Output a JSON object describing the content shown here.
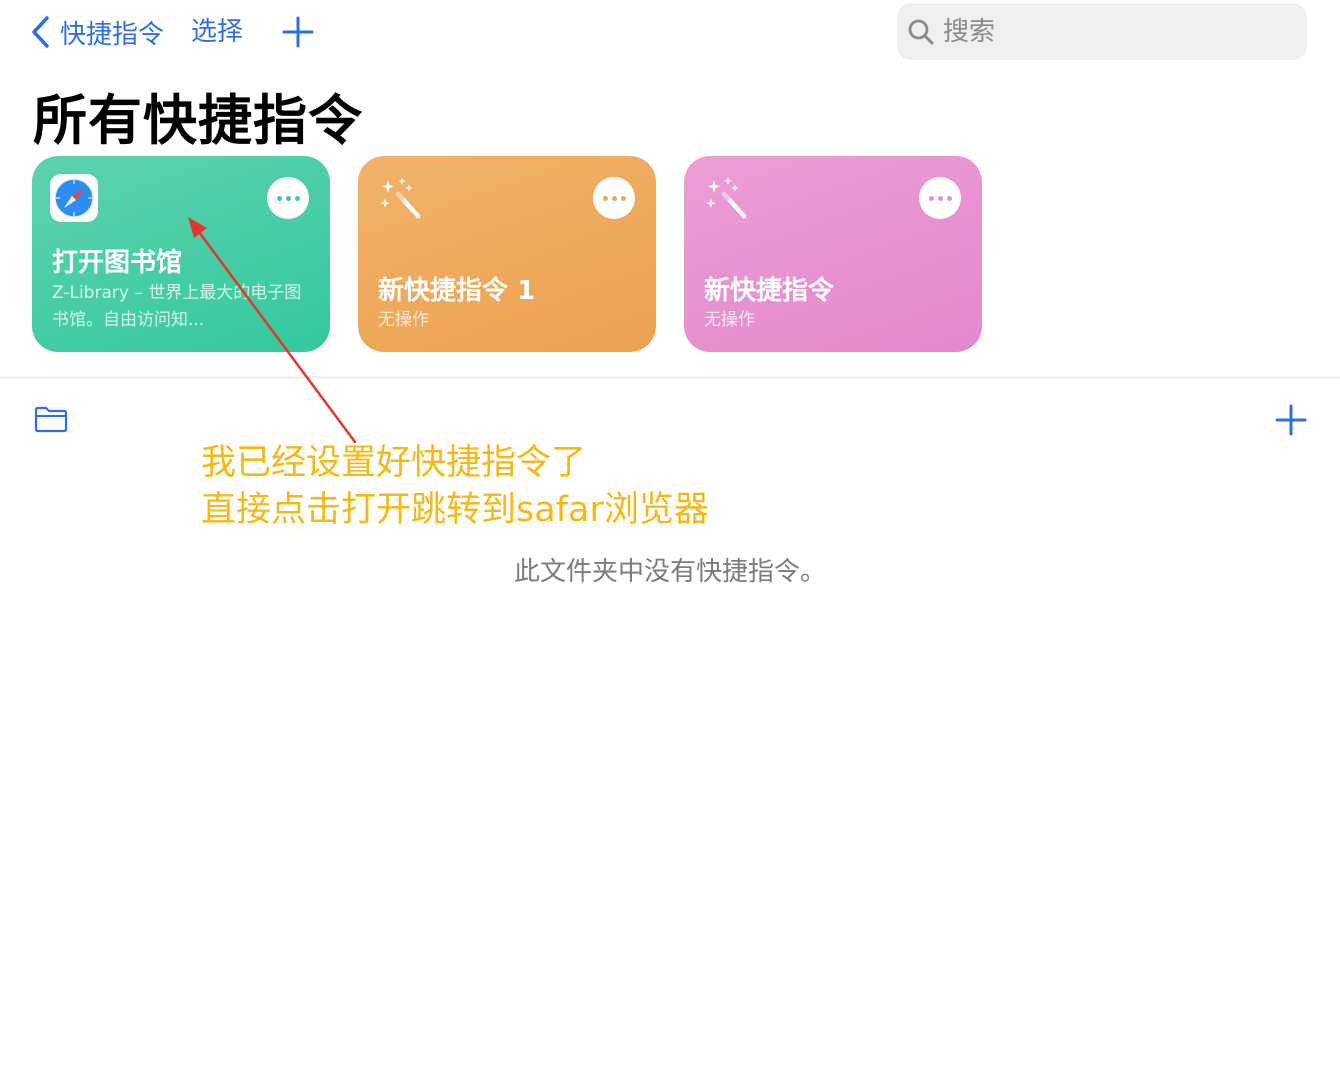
{
  "nav": {
    "back_label": "快捷指令",
    "select_label": "选择"
  },
  "search": {
    "placeholder": "搜索",
    "value": ""
  },
  "page_title": "所有快捷指令",
  "shortcuts": [
    {
      "title": "打开图书馆",
      "subtitle": "Z-Library – 世界上最大的电子图书馆。自由访问知...",
      "color": "#3fc9a3",
      "icon": "safari-compass-icon"
    },
    {
      "title": "新快捷指令 1",
      "subtitle": "无操作",
      "color": "#eda655",
      "icon": "magic-wand-sparkles-icon"
    },
    {
      "title": "新快捷指令",
      "subtitle": "无操作",
      "color": "#e68fd0",
      "icon": "magic-wand-sparkles-icon"
    }
  ],
  "folder_section": {
    "empty_text": "此文件夹中没有快捷指令。"
  },
  "annotation": {
    "line1": "我已经设置好快捷指令了",
    "line2": "直接点击打开跳转到safar浏览器",
    "color": "#f7b814",
    "arrow_color": "#e6342a"
  },
  "accent_color": "#2f6fdf"
}
